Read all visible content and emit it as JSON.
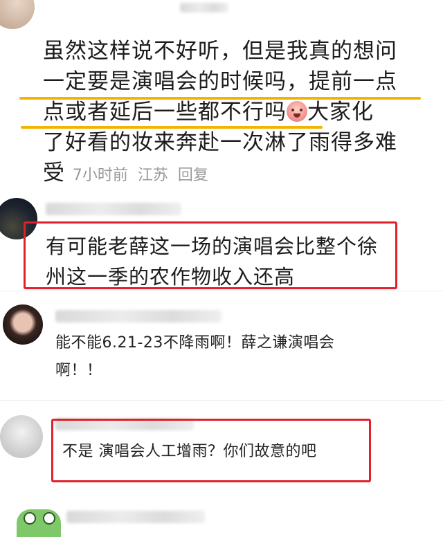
{
  "comments": [
    {
      "lines": [
        "虽然这样说不好听，但是我真的想问",
        "一定要是演唱会的时候吗，提前一点",
        "点或者延后一些都不行吗",
        "大家化",
        "了好看的妆来奔赴一次淋了雨得多难",
        "受"
      ],
      "emoji_icon": "crying-face-emoji",
      "time": "7小时前",
      "location": "江苏",
      "reply_label": "回复",
      "highlight_color": "#f2b400"
    },
    {
      "lines": [
        "有可能老薛这一场的演唱会比整个徐",
        "州这一季的农作物收入还高"
      ],
      "box_color": "#e0202a"
    },
    {
      "lines": [
        "能不能6.21-23不降雨啊！薛之谦演唱会",
        "啊！！"
      ]
    },
    {
      "lines": [
        "不是 演唱会人工增雨？你们故意的吧"
      ],
      "box_color": "#e0202a"
    }
  ]
}
